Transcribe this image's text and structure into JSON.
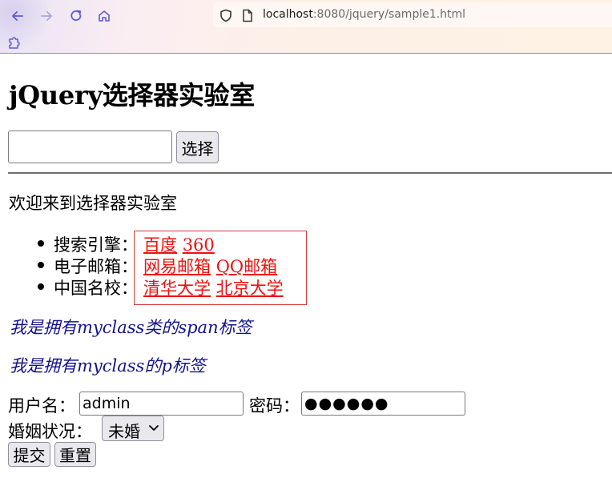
{
  "browser": {
    "url_host": "localhost",
    "url_rest": ":8080/jquery/sample1.html",
    "icons": [
      "back-icon",
      "forward-icon",
      "reload-icon",
      "home-icon",
      "shield-icon",
      "page-icon",
      "extension-icon"
    ]
  },
  "page": {
    "title": "jQuery选择器实验室",
    "search": {
      "value": "",
      "button_label": "选择"
    },
    "welcome": "欢迎来到选择器实验室",
    "list": [
      {
        "label": "搜索引擎：",
        "links": [
          "百度",
          "360"
        ]
      },
      {
        "label": "电子邮箱：",
        "links": [
          "网易邮箱",
          "QQ邮箱"
        ]
      },
      {
        "label": "中国名校：",
        "links": [
          "清华大学",
          "北京大学"
        ]
      }
    ],
    "span_text": "我是拥有myclass类的span标签",
    "p_text": "我是拥有myclass的p标签",
    "form": {
      "username_label": "用户名：",
      "username_value": "admin",
      "password_label": "密码：",
      "password_value": "●●●●●●",
      "marital_label": "婚姻状况：",
      "marital_selected": "未婚",
      "submit_label": "提交",
      "reset_label": "重置"
    }
  },
  "colors": {
    "link": "#ee1010",
    "myclass_text": "#12128c",
    "box_border": "#d63b3b"
  }
}
